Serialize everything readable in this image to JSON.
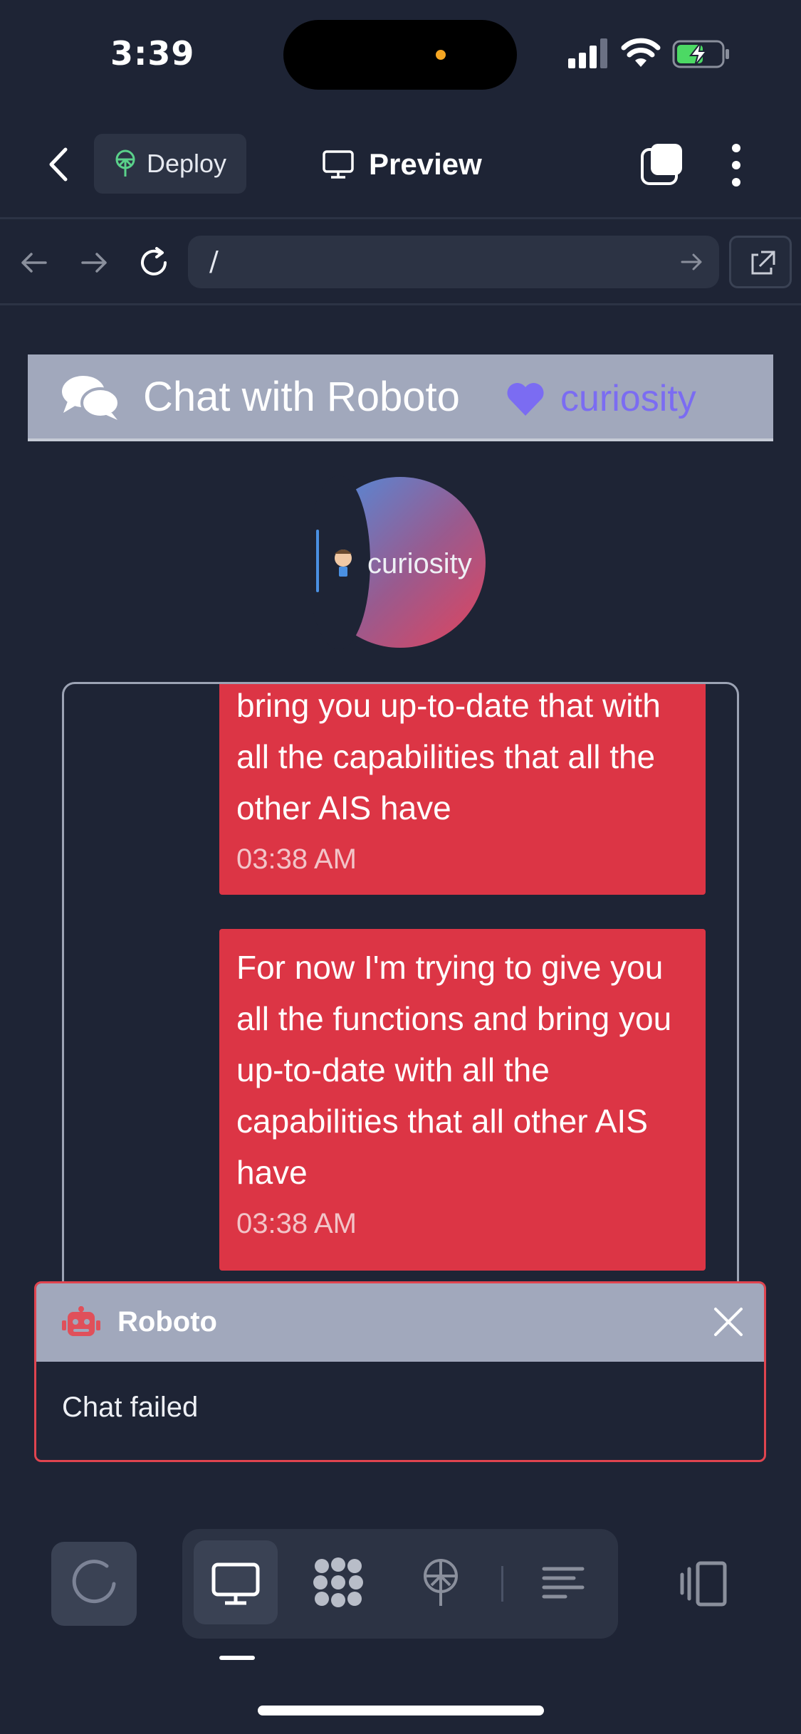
{
  "status_bar": {
    "time": "3:39"
  },
  "top_bar": {
    "deploy_label": "Deploy",
    "preview_label": "Preview"
  },
  "browser": {
    "url": "/"
  },
  "app": {
    "title": "Chat with Roboto",
    "emotion": "curiosity",
    "avatar_label": "curiosity",
    "accent_color": "#7b6cf2"
  },
  "messages": [
    {
      "text": "bring you up-to-date that with all the capabilities that all the other AIS have",
      "time": "03:38 AM"
    },
    {
      "text": "For now I'm trying to give you all the functions and bring you up-to-date with all the capabilities that all other AIS have",
      "time": "03:38 AM"
    }
  ],
  "toast": {
    "title": "Roboto",
    "message": "Chat failed",
    "accent_color": "#dc3545"
  },
  "icons": [
    "back-icon",
    "deploy-icon",
    "monitor-icon",
    "tabs-icon",
    "more-icon",
    "arrow-left-icon",
    "arrow-right-icon",
    "reload-icon",
    "external-link-icon",
    "chat-bubbles-icon",
    "heart-icon",
    "robot-icon",
    "close-icon",
    "spinner-icon",
    "desktop-icon",
    "dots-grid-icon",
    "deploy-tool-icon",
    "lines-icon",
    "panel-icon"
  ]
}
